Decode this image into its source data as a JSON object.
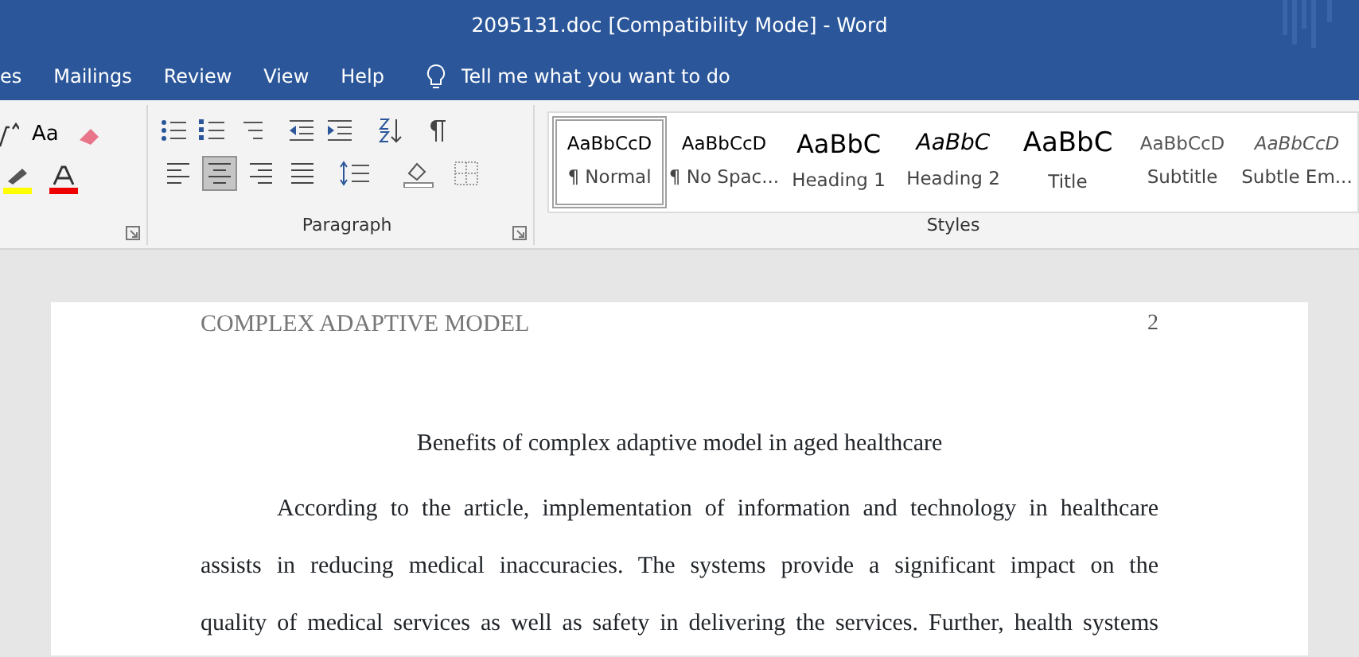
{
  "window": {
    "title": "2095131.doc [Compatibility Mode]  -  Word"
  },
  "tabs": [
    {
      "label": "es",
      "selected": false
    },
    {
      "label": "Mailings",
      "selected": false
    },
    {
      "label": "Review",
      "selected": false
    },
    {
      "label": "View",
      "selected": false
    },
    {
      "label": "Help",
      "selected": false
    }
  ],
  "tell_me": {
    "placeholder": "Tell me what you want to do"
  },
  "font_group": {
    "change_case": "Aa"
  },
  "paragraph_group": {
    "label": "Paragraph",
    "align_buttons": [
      {
        "kind": "left",
        "selected": false
      },
      {
        "kind": "center",
        "selected": true
      },
      {
        "kind": "right",
        "selected": false
      },
      {
        "kind": "justify",
        "selected": false
      }
    ]
  },
  "styles_group": {
    "label": "Styles",
    "styles": [
      {
        "preview": "AaBbCcD",
        "name": "¶ Normal",
        "kind": "normal",
        "selected": true
      },
      {
        "preview": "AaBbCcD",
        "name": "¶ No Spac...",
        "kind": "normal",
        "selected": false
      },
      {
        "preview": "AaBbC",
        "name": "Heading 1",
        "kind": "heading1",
        "selected": false
      },
      {
        "preview": "AaBbC",
        "name": "Heading 2",
        "kind": "heading2",
        "selected": false
      },
      {
        "preview": "AaBbC",
        "name": "Title",
        "kind": "title",
        "selected": false
      },
      {
        "preview": "AaBbCcD",
        "name": "Subtitle",
        "kind": "subtitle",
        "selected": false
      },
      {
        "preview": "AaBbCcD",
        "name": "Subtle Em...",
        "kind": "subtle",
        "selected": false
      }
    ]
  },
  "document": {
    "header": "COMPLEX ADAPTIVE MODEL",
    "page_number": "2",
    "heading": "Benefits of complex adaptive model in aged healthcare",
    "paragraph_lines": [
      "According to the article, implementation of information and technology in healthcare",
      "assists in reducing medical inaccuracies. The systems provide a significant impact on the",
      "quality of medical services as well as safety in delivering the services. Further, health systems"
    ]
  }
}
